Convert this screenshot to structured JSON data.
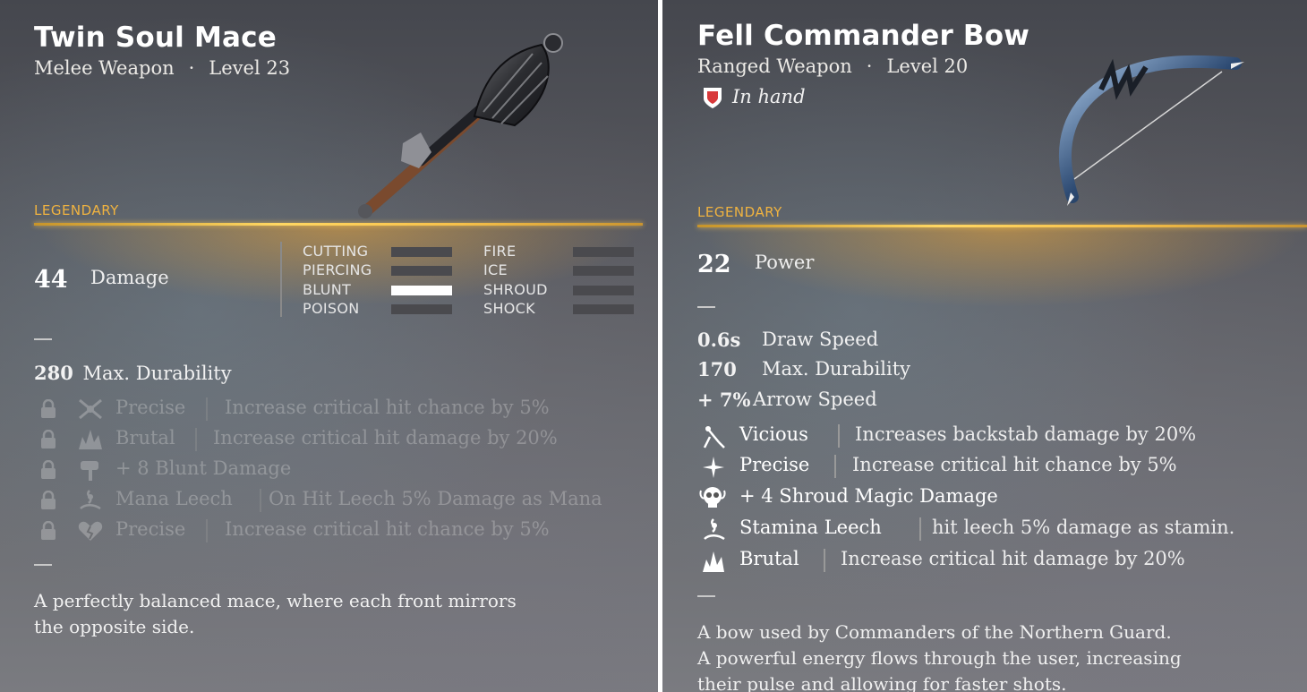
{
  "left_card": {
    "title": "Twin Soul Mace",
    "type": "Melee Weapon",
    "level": "Level 23",
    "rarity": "LEGENDARY",
    "primary_value": "44",
    "primary_label": "Damage",
    "damage_types": [
      {
        "label": "CUTTING",
        "active": false
      },
      {
        "label": "PIERCING",
        "active": false
      },
      {
        "label": "BLUNT",
        "active": true
      },
      {
        "label": "POISON",
        "active": false
      },
      {
        "label": "FIRE",
        "active": false
      },
      {
        "label": "ICE",
        "active": false
      },
      {
        "label": "SHROUD",
        "active": false
      },
      {
        "label": "SHOCK",
        "active": false
      }
    ],
    "stat_durability_value": "280",
    "stat_durability_label": "Max. Durability",
    "perks": [
      {
        "icon": "crossed-swords-icon",
        "name": "Precise",
        "desc": "Increase critical hit chance by 5%"
      },
      {
        "icon": "burst-icon",
        "name": "Brutal",
        "desc": "Increase critical hit damage by 20%"
      },
      {
        "icon": "hammer-icon",
        "name": "+ 8  Blunt Damage",
        "desc": ""
      },
      {
        "icon": "leech-icon",
        "name": "Mana Leech",
        "desc": "On Hit Leech 5% Damage as Mana"
      },
      {
        "icon": "heart-break-icon",
        "name": "Precise",
        "desc": "Increase critical hit chance by 5%"
      }
    ],
    "lore_lines": [
      "A perfectly balanced mace, where each front mirrors",
      "the opposite side."
    ],
    "weapon_image": "mace-icon"
  },
  "right_card": {
    "title": "Fell Commander Bow",
    "type": "Ranged Weapon",
    "level": "Level 20",
    "status": "In hand",
    "status_icon": "shield-hand-icon",
    "rarity": "LEGENDARY",
    "primary_value": "22",
    "primary_label": "Power",
    "stats": [
      {
        "value": "0.6s",
        "label": "Draw Speed"
      },
      {
        "value": "170",
        "label": "Max. Durability"
      },
      {
        "value": "+ 7%",
        "label": "Arrow Speed"
      }
    ],
    "perks": [
      {
        "icon": "backstab-icon",
        "name": "Vicious",
        "desc": "Increases backstab damage by 20%"
      },
      {
        "icon": "sparkle-icon",
        "name": "Precise",
        "desc": "Increase critical hit chance by 5%"
      },
      {
        "icon": "skull-icon",
        "name": "+ 4  Shroud Magic Damage",
        "desc": ""
      },
      {
        "icon": "leech-icon",
        "name": "Stamina Leech",
        "desc": "hit leech 5% damage as stamin."
      },
      {
        "icon": "burst-icon",
        "name": "Brutal",
        "desc": "Increase critical hit damage by 20%"
      }
    ],
    "lore_lines": [
      "A bow used by Commanders of the Northern Guard.",
      "A powerful energy flows through the user, increasing",
      "their pulse and allowing for faster shots."
    ],
    "weapon_image": "bow-icon"
  },
  "colors": {
    "rarity_gold": "#f0b340",
    "active_bar": "#ffffff",
    "inactive_bar": "#4a4a4e"
  }
}
